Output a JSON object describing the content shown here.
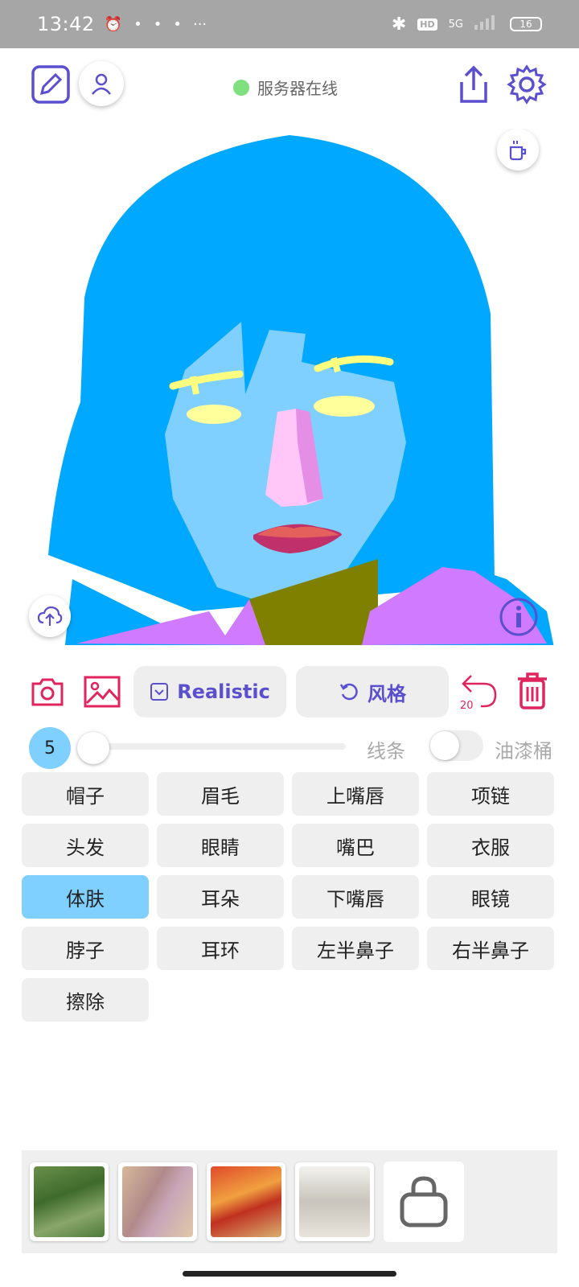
{
  "status_bar": {
    "time": "13:42",
    "network": "5G",
    "hd": "HD",
    "battery": "16"
  },
  "server": {
    "status_text": "服务器在线",
    "status_color": "#7ee07e"
  },
  "toolbar": {
    "style_model_label": "Realistic",
    "style_label": "风格",
    "undo_count": "20"
  },
  "brush": {
    "size": "5",
    "size_value": 5,
    "line_label": "线条",
    "line_enabled": false,
    "bucket_label": "油漆桶"
  },
  "parts": [
    {
      "label": "帽子",
      "active": false
    },
    {
      "label": "眉毛",
      "active": false
    },
    {
      "label": "上嘴唇",
      "active": false
    },
    {
      "label": "项链",
      "active": false
    },
    {
      "label": "头发",
      "active": false
    },
    {
      "label": "眼睛",
      "active": false
    },
    {
      "label": "嘴巴",
      "active": false
    },
    {
      "label": "衣服",
      "active": false
    },
    {
      "label": "体肤",
      "active": true
    },
    {
      "label": "耳朵",
      "active": false
    },
    {
      "label": "下嘴唇",
      "active": false
    },
    {
      "label": "眼镜",
      "active": false
    },
    {
      "label": "脖子",
      "active": false
    },
    {
      "label": "耳环",
      "active": false
    },
    {
      "label": "左半鼻子",
      "active": false
    },
    {
      "label": "右半鼻子",
      "active": false
    },
    {
      "label": "擦除",
      "active": false
    }
  ],
  "colors": {
    "accent": "#5a4fcf",
    "danger": "#e0245e",
    "selected": "#7fd0ff",
    "hair": "#00a8ff",
    "skin": "#7fd0ff"
  },
  "icons": [
    "edit-icon",
    "user-icon",
    "share-icon",
    "gear-icon",
    "coffee-icon",
    "upload-cloud-icon",
    "info-icon",
    "camera-icon",
    "image-icon",
    "undo-icon",
    "trash-icon",
    "bag-icon"
  ]
}
